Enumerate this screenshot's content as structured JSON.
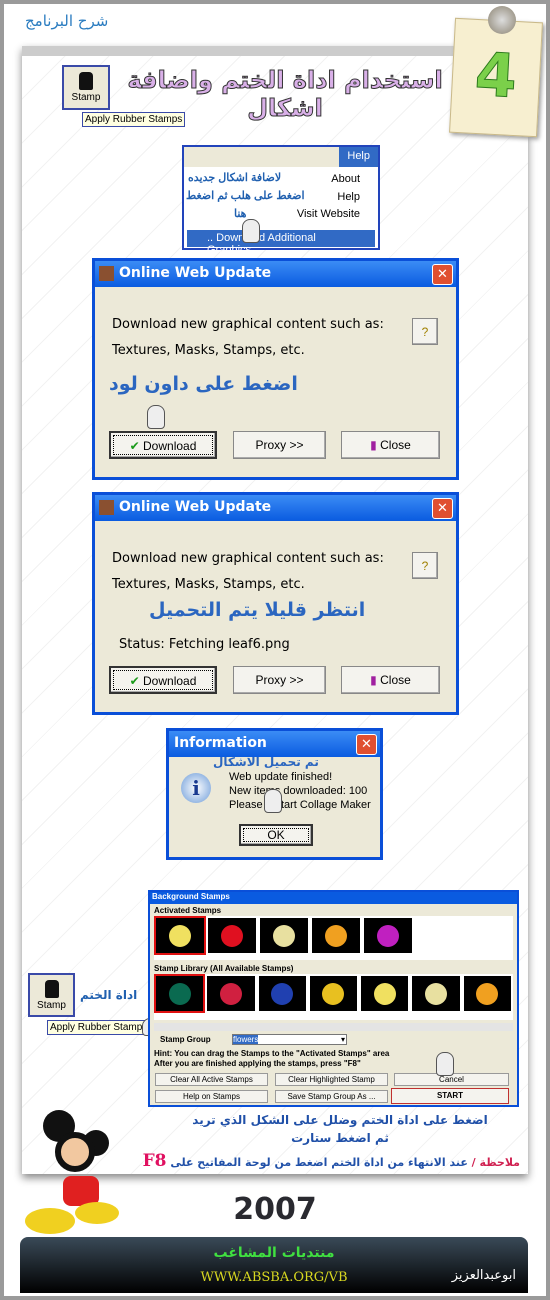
{
  "header": {
    "section_title": "شرح البرنامج",
    "step_number": "4",
    "title": "استخدام اداة الختم واضافة اشكال"
  },
  "stamp_tool": {
    "label": "Stamp",
    "tooltip": "Apply Rubber Stamps"
  },
  "help_menu": {
    "menu_label": "Help",
    "items": [
      "About",
      "Help",
      "Visit Website",
      ".. Download Additional Graphics"
    ],
    "annotation_lines": [
      "لاضافة اشكال جديده",
      "اضغط على هلب ثم اضغط",
      "هنا"
    ]
  },
  "dialog1": {
    "title": "Online Web Update",
    "line1": "Download new graphical content such as:",
    "line2": "Textures, Masks, Stamps, etc.",
    "annotation": "اضغط على داون لود",
    "help_button": "?",
    "buttons": {
      "download": "Download",
      "proxy": "Proxy >>",
      "close": "Close"
    }
  },
  "dialog2": {
    "title": "Online Web Update",
    "line1": "Download new graphical content such as:",
    "line2": "Textures, Masks, Stamps, etc.",
    "annotation": "انتظر قليلا يتم التحميل",
    "status": "Status: Fetching leaf6.png",
    "help_button": "?",
    "buttons": {
      "download": "Download",
      "proxy": "Proxy >>",
      "close": "Close"
    }
  },
  "info_dialog": {
    "title": "Information",
    "annotation": "تم تحميل الاشكال",
    "lines": [
      "Web update finished!",
      "New items downloaded: 100",
      "Please restart Collage Maker"
    ],
    "ok": "OK"
  },
  "stamps_dialog": {
    "title": "Background Stamps",
    "activated_label": "Activated Stamps",
    "library_label": "Stamp Library (All Available Stamps)",
    "activated_colors": [
      "#f0e060",
      "#e01020",
      "#e8e0a0",
      "#f0a020",
      "#c020c0"
    ],
    "library_colors": [
      "#0a6a50",
      "#d02040",
      "#2040b0",
      "#e8c020",
      "#f0e060",
      "#e8e0a0",
      "#f0a020"
    ],
    "group_label": "Stamp Group",
    "group_value": "flowers",
    "hint1": "Hint: You can drag the Stamps to the \"Activated Stamps\" area",
    "hint2": "After you are finished applying the stamps, press \"F8\"",
    "buttons": {
      "clear_all": "Clear All Active Stamps",
      "clear_highlighted": "Clear Highlighted Stamp",
      "cancel": "Cancel",
      "help": "Help on Stamps",
      "save_group": "Save Stamp Group As ...",
      "start": "START"
    }
  },
  "side_label": "اداة الختم",
  "instructions": {
    "line1": "اضغط على اداة الختم وضلل على الشكل الذي تريد",
    "line2": "ثم اضغط ستارت",
    "note_label": "ملاحظة /",
    "note": "عند الانتهاء من اداة الختم اضغط من لوحة المفاتيح على",
    "key": "F8"
  },
  "year": "2007",
  "footer": {
    "forum": "منتديات المشاغب",
    "url": "WWW.ABSBA.ORG/VB",
    "author": "ابوعبدالعزيز"
  }
}
